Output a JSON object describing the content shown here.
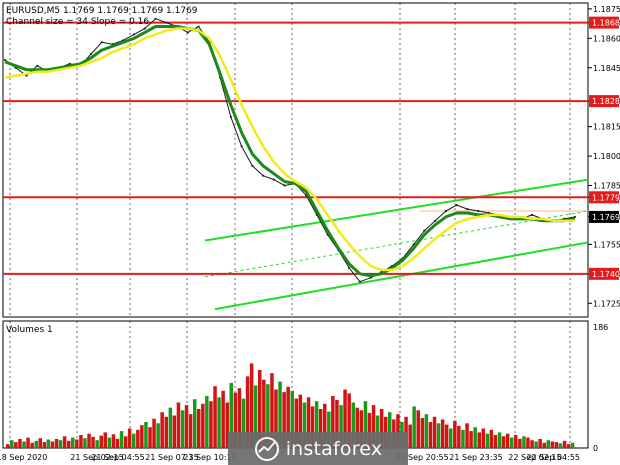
{
  "chart_data": {
    "type": "line",
    "symbol_header": "EURUSD,M5  1.1769 1.1769 1.1769 1.1769",
    "indicator_label": "Channel size = 34 Slope = 0.16",
    "volumes_label": "Volumes 1",
    "y_ticks": [
      "1.1875",
      "1.1868",
      "1.1860",
      "1.1845",
      "1.1828",
      "1.1815",
      "1.1800",
      "1.1785",
      "1.1779",
      "1.1769",
      "1.1755",
      "1.1740",
      "1.1725"
    ],
    "volume_ticks": [
      "186",
      "0"
    ],
    "x_ticks": [
      "18 Sep 2020",
      "21 Sep 02:15",
      "21 Sep 04:55",
      "21 Sep 07:35",
      "21 Sep 10:15",
      "21 Sep 20:55",
      "21 Sep 23:35",
      "22 Sep 02:15",
      "22 Sep 04:55"
    ],
    "ylim": [
      1.1718,
      1.1878
    ],
    "horizontal_levels": [
      {
        "value": 1.1868,
        "label": "1.1868",
        "color": "#e31b1b"
      },
      {
        "value": 1.1828,
        "label": "1.1828",
        "color": "#e31b1b"
      },
      {
        "value": 1.1779,
        "label": "1.1779",
        "color": "#e31b1b"
      },
      {
        "value": 1.174,
        "label": "1.1740",
        "color": "#e31b1b"
      }
    ],
    "current_price": {
      "value": 1.1769,
      "label": "1.1769"
    },
    "channel": {
      "color": "#22dd22",
      "upper": [
        1.1757,
        1.1788
      ],
      "lower": [
        1.1722,
        1.1756
      ]
    },
    "series": [
      {
        "color": "#1a1a1a",
        "values": [
          1.1849,
          1.1845,
          1.1841,
          1.1846,
          1.1843,
          1.1845,
          1.1847,
          1.1846,
          1.1852,
          1.1858,
          1.1857,
          1.1859,
          1.1862,
          1.1865,
          1.187,
          1.1868,
          1.1866,
          1.1863,
          1.1866,
          1.1858,
          1.184,
          1.182,
          1.1805,
          1.1795,
          1.179,
          1.1788,
          1.1785,
          1.1786,
          1.178,
          1.177,
          1.176,
          1.1752,
          1.1743,
          1.1736,
          1.1738,
          1.1741,
          1.1744,
          1.1748,
          1.1755,
          1.1762,
          1.1767,
          1.1772,
          1.1775,
          1.1773,
          1.1772,
          1.1771,
          1.177,
          1.1769,
          1.1768,
          1.177,
          1.1768,
          1.1767,
          1.1768,
          1.1769
        ]
      },
      {
        "color": "#1b8a1b",
        "values": [
          1.1848,
          1.1846,
          1.1844,
          1.1844,
          1.1844,
          1.1845,
          1.1846,
          1.1847,
          1.185,
          1.1854,
          1.1856,
          1.1858,
          1.186,
          1.1863,
          1.1866,
          1.1866,
          1.1866,
          1.1865,
          1.1864,
          1.1857,
          1.1842,
          1.1826,
          1.1812,
          1.1801,
          1.1795,
          1.1791,
          1.1787,
          1.1786,
          1.1782,
          1.1772,
          1.1762,
          1.1753,
          1.1745,
          1.174,
          1.1739,
          1.174,
          1.1743,
          1.1747,
          1.1753,
          1.176,
          1.1765,
          1.1769,
          1.1771,
          1.1771,
          1.177,
          1.177,
          1.1769,
          1.1768,
          1.1768,
          1.1768,
          1.1767,
          1.1767,
          1.1767,
          1.1768
        ]
      },
      {
        "color": "#f2ea1a",
        "values": [
          1.184,
          1.1841,
          1.1842,
          1.1843,
          1.1843,
          1.1844,
          1.1845,
          1.1846,
          1.1848,
          1.185,
          1.1853,
          1.1855,
          1.1857,
          1.186,
          1.1862,
          1.1864,
          1.1865,
          1.1865,
          1.1864,
          1.186,
          1.1851,
          1.1839,
          1.1826,
          1.1815,
          1.1805,
          1.1797,
          1.1791,
          1.1787,
          1.1784,
          1.1778,
          1.177,
          1.1762,
          1.1755,
          1.1749,
          1.1744,
          1.1742,
          1.1742,
          1.1744,
          1.1748,
          1.1753,
          1.1758,
          1.1762,
          1.1766,
          1.1768,
          1.1769,
          1.177,
          1.177,
          1.1769,
          1.1769,
          1.1768,
          1.1768,
          1.1767,
          1.1767,
          1.1767
        ]
      }
    ],
    "volumes": [
      6,
      12,
      9,
      14,
      10,
      16,
      8,
      11,
      15,
      9,
      13,
      10,
      14,
      12,
      18,
      11,
      16,
      13,
      20,
      15,
      22,
      17,
      12,
      19,
      24,
      16,
      21,
      14,
      26,
      18,
      30,
      22,
      28,
      35,
      40,
      32,
      45,
      38,
      55,
      48,
      62,
      50,
      70,
      58,
      66,
      52,
      75,
      60,
      68,
      80,
      72,
      95,
      78,
      88,
      70,
      100,
      85,
      92,
      76,
      110,
      130,
      96,
      120,
      105,
      98,
      115,
      90,
      102,
      86,
      94,
      88,
      76,
      82,
      70,
      78,
      64,
      72,
      60,
      68,
      56,
      80,
      74,
      66,
      90,
      84,
      70,
      62,
      58,
      72,
      54,
      66,
      50,
      60,
      48,
      55,
      44,
      52,
      40,
      48,
      36,
      64,
      58,
      46,
      52,
      40,
      48,
      38,
      44,
      36,
      30,
      42,
      34,
      28,
      38,
      26,
      32,
      24,
      30,
      22,
      28,
      20,
      24,
      18,
      22,
      16,
      20,
      14,
      18,
      16,
      12,
      10,
      14,
      8,
      12,
      10,
      9,
      7,
      11,
      6,
      8
    ]
  },
  "watermark": {
    "brand": "instaforex"
  }
}
